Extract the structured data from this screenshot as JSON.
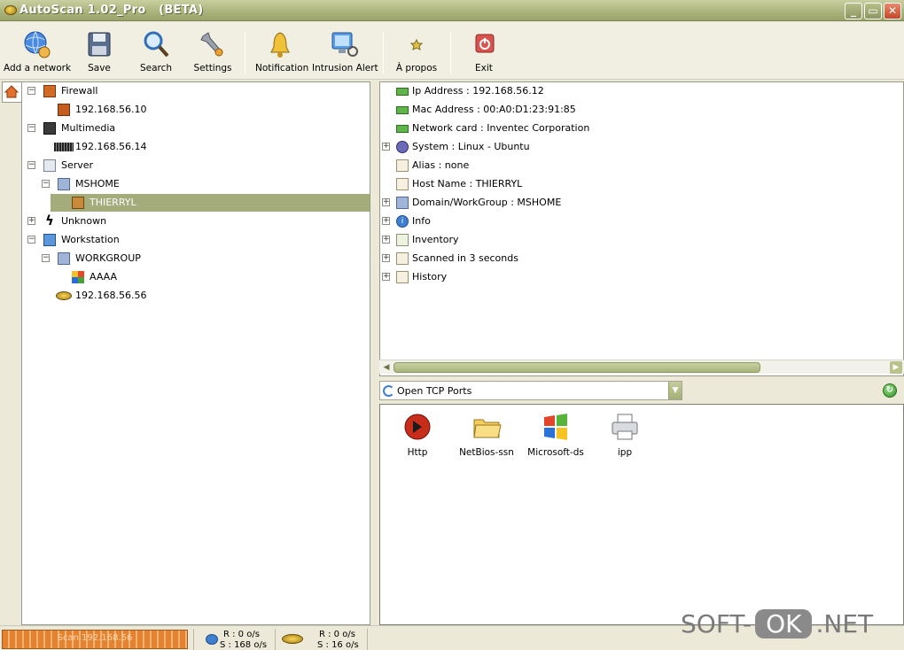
{
  "window": {
    "title": "AutoScan 1.02_Pro   (BETA)",
    "minimize": "_",
    "restore": "▭",
    "close": "✕"
  },
  "toolbar": {
    "add_network": "Add a network",
    "save": "Save",
    "search": "Search",
    "settings": "Settings",
    "notification": "Notification",
    "intrusion_alert": "Intrusion Alert",
    "about": "À propos",
    "exit": "Exit"
  },
  "tree": {
    "firewall": "Firewall",
    "firewall_ip": "192.168.56.10",
    "multimedia": "Multimedia",
    "multimedia_ip": "192.168.56.14",
    "server": "Server",
    "mshome": "MSHOME",
    "thierryl": "THIERRYL",
    "unknown": "Unknown",
    "workstation": "Workstation",
    "workgroup": "WORKGROUP",
    "aaaa": "AAAA",
    "ws_ip": "192.168.56.56"
  },
  "details": {
    "ip": "Ip Address : 192.168.56.12",
    "mac": "Mac Address : 00:A0:D1:23:91:85",
    "nic": "Network card : Inventec Corporation",
    "system": "System : Linux - Ubuntu",
    "alias": "Alias : none",
    "host": "Host Name : THIERRYL",
    "domain": "Domain/WorkGroup : MSHOME",
    "info": "Info",
    "inventory": "Inventory",
    "scanned": "Scanned in 3 seconds",
    "history": "History"
  },
  "ports": {
    "combo_value": "Open TCP Ports",
    "items": [
      "Http",
      "NetBios-ssn",
      "Microsoft-ds",
      "ipp"
    ]
  },
  "status": {
    "progress_text": "Scan 192.168.56",
    "net1_r": "R : 0 o/s",
    "net1_s": "S : 168 o/s",
    "net2_r": "R : 0 o/s",
    "net2_s": "S : 16 o/s"
  },
  "watermark": {
    "left": "SOFT-",
    "box": "OK",
    "right": ".NET"
  },
  "colors": {
    "titlebar": "#a9b279",
    "selection": "#a3ac7a",
    "progress": "#e6822d"
  }
}
